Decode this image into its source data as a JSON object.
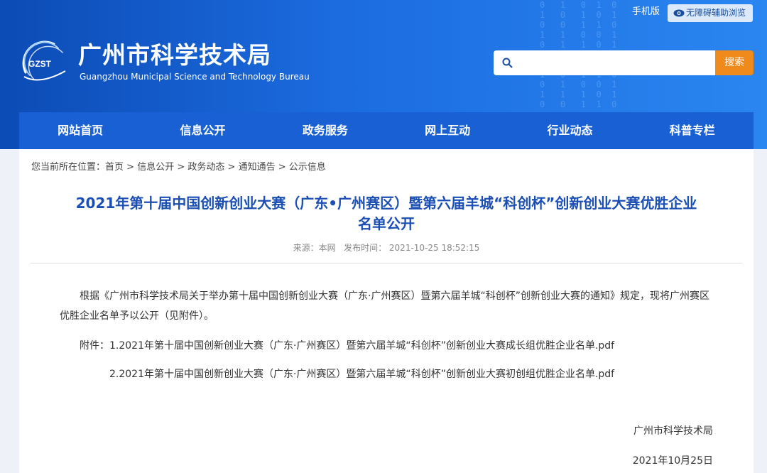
{
  "header": {
    "logo_text": "GZST",
    "title": "广州市科学技术局",
    "subtitle": "Guangzhou Municipal Science and Technology Bureau",
    "mobile_label": "手机版",
    "accessibility_label": "无障碍辅助浏览",
    "search_placeholder": "",
    "search_button": "搜索"
  },
  "nav": {
    "items": [
      "网站首页",
      "信息公开",
      "政务服务",
      "网上互动",
      "行业动态",
      "科普专栏"
    ]
  },
  "breadcrumb": {
    "prefix": "您当前所在位置：",
    "items": [
      "首页",
      "信息公开",
      "政务动态",
      "通知通告",
      "公示信息"
    ],
    "separator": " > "
  },
  "article": {
    "title_line1": "2021年第十届中国创新创业大赛（广东•广州赛区）暨第六届羊城“科创杯”创新创业大赛优胜企业",
    "title_line2": "名单公开",
    "source": "来源：本网",
    "publish_time": "发布时间： 2021-10-25 18:52:15",
    "body_line1": "根据《广州市科学技术局关于举办第十届中国创新创业大赛（广东·广州赛区）暨第六届羊城“科创杯”创新创业大赛的通知》规定，现将广州赛区",
    "body_line2": "优胜企业名单予以公开（见附件）。",
    "attachment_prefix": "附件：",
    "attachments": [
      "1.2021年第十届中国创新创业大赛（广东·广州赛区）暨第六届羊城“科创杯”创新创业大赛成长组优胜企业名单.pdf",
      "2.2021年第十届中国创新创业大赛（广东·广州赛区）暨第六届羊城“科创杯”创新创业大赛初创组优胜企业名单.pdf"
    ],
    "signature": "广州市科学技术局",
    "date": "2021年10月25日"
  },
  "colors": {
    "header_blue": "#1c6ce0",
    "nav_blue": "#1860d4",
    "title_blue": "#1b4fb3",
    "search_orange": "#f08a1a"
  }
}
